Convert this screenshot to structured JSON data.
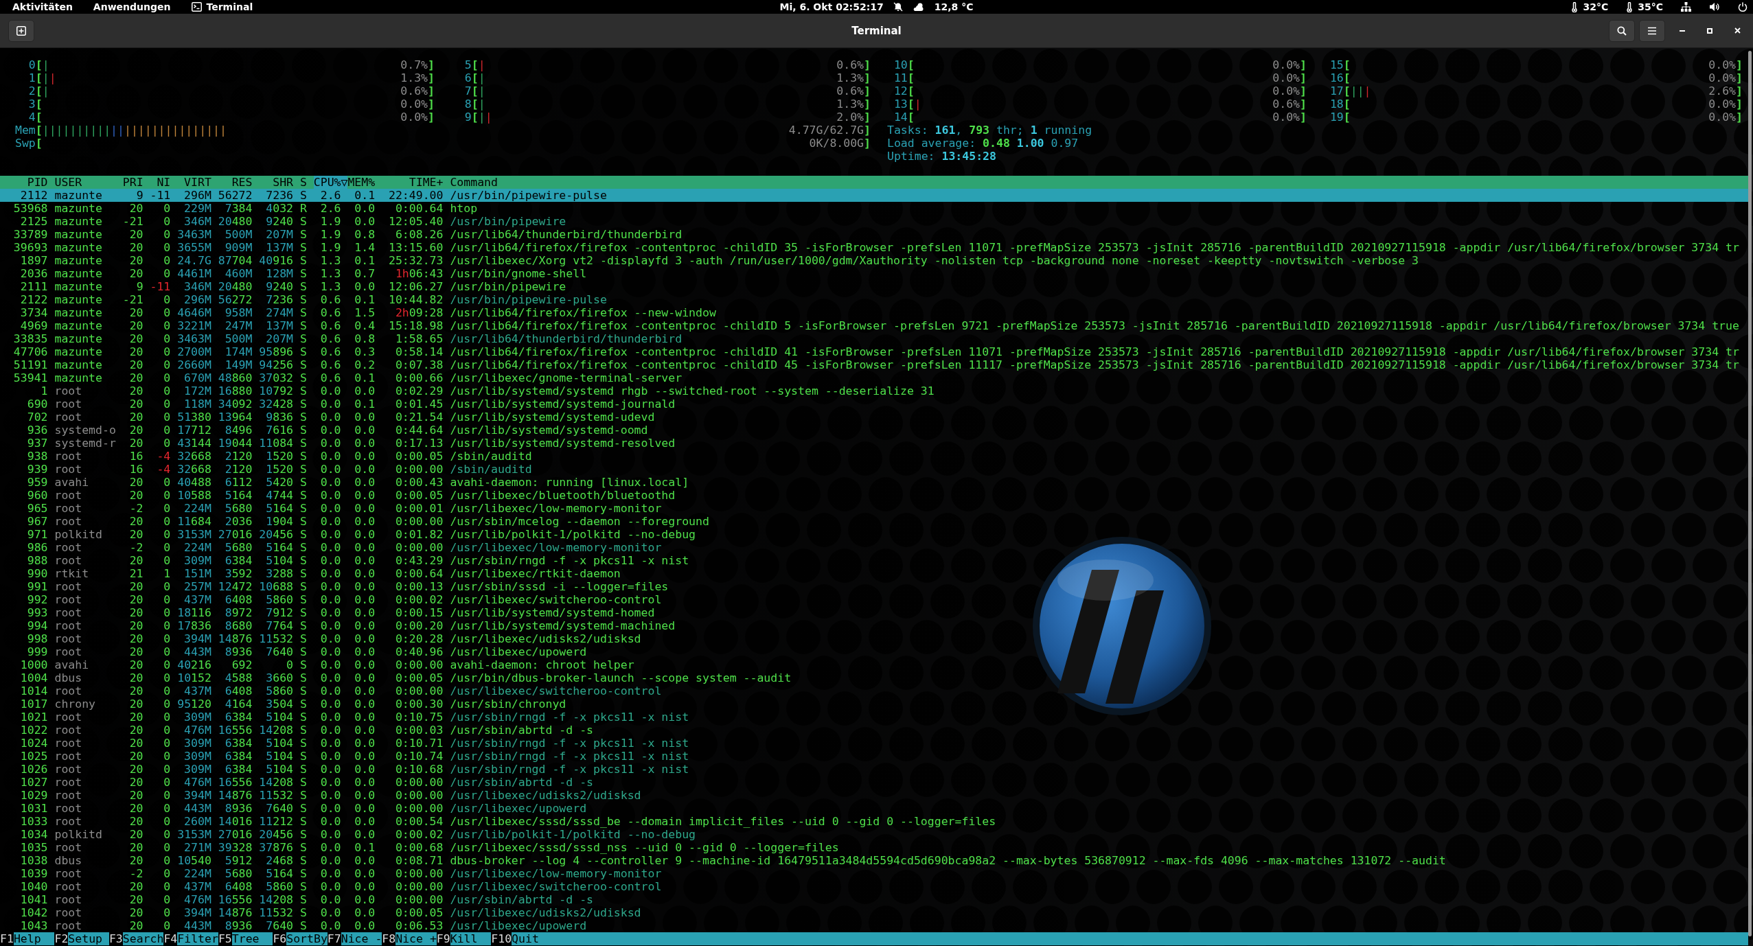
{
  "top_bar": {
    "activities": "Aktivitäten",
    "applications": "Anwendungen",
    "app": "Terminal",
    "clock": "Mi, 6. Okt 02:52:17",
    "weather": "12,8 °C",
    "temperatures": [
      "32°C",
      "35°C"
    ]
  },
  "window": {
    "title": "Terminal"
  },
  "cpus": [
    {
      "label": "0",
      "open": "[",
      "segments": [
        {
          "kind": "user",
          "text": "|"
        }
      ],
      "reading": "0.7%",
      "close": "]"
    },
    {
      "label": "1",
      "open": "[",
      "segments": [
        {
          "kind": "user",
          "text": "|"
        },
        {
          "kind": "kernel",
          "text": "|"
        }
      ],
      "reading": "1.3%",
      "close": "]"
    },
    {
      "label": "2",
      "open": "[",
      "segments": [
        {
          "kind": "user",
          "text": "|"
        }
      ],
      "reading": "0.6%",
      "close": "]"
    },
    {
      "label": "3",
      "open": "[",
      "reading": "0.0%",
      "close": "]"
    },
    {
      "label": "4",
      "open": "[",
      "reading": "0.0%",
      "close": "]"
    },
    {
      "label": "5",
      "open": "[",
      "segments": [
        {
          "kind": "kernel",
          "text": "|"
        }
      ],
      "reading": "0.6%",
      "close": "]"
    },
    {
      "label": "6",
      "open": "[",
      "segments": [
        {
          "kind": "user",
          "text": "|"
        }
      ],
      "reading": "1.3%",
      "close": "]"
    },
    {
      "label": "7",
      "open": "[",
      "segments": [
        {
          "kind": "user",
          "text": "|"
        }
      ],
      "reading": "0.6%",
      "close": "]"
    },
    {
      "label": "8",
      "open": "[",
      "segments": [
        {
          "kind": "user",
          "text": "|"
        }
      ],
      "reading": "1.3%",
      "close": "]"
    },
    {
      "label": "9",
      "open": "[",
      "segments": [
        {
          "kind": "user",
          "text": "|"
        },
        {
          "kind": "kernel",
          "text": "|"
        }
      ],
      "reading": "2.0%",
      "close": "]"
    },
    {
      "label": "10",
      "open": "[",
      "reading": "0.0%",
      "close": "]"
    },
    {
      "label": "11",
      "open": "[",
      "reading": "0.0%",
      "close": "]"
    },
    {
      "label": "12",
      "open": "[",
      "reading": "0.0%",
      "close": "]"
    },
    {
      "label": "13",
      "open": "[",
      "segments": [
        {
          "kind": "kernel",
          "text": "|"
        }
      ],
      "reading": "0.6%",
      "close": "]"
    },
    {
      "label": "14",
      "open": "[",
      "reading": "0.0%",
      "close": "]"
    },
    {
      "label": "15",
      "open": "[",
      "reading": "0.0%",
      "close": "]"
    },
    {
      "label": "16",
      "open": "[",
      "reading": "0.0%",
      "close": "]"
    },
    {
      "label": "17",
      "open": "[",
      "segments": [
        {
          "kind": "user",
          "text": "||"
        },
        {
          "kind": "kernel",
          "text": "|"
        }
      ],
      "reading": "2.6%",
      "close": "]"
    },
    {
      "label": "18",
      "open": "[",
      "reading": "0.0%",
      "close": "]"
    },
    {
      "label": "19",
      "open": "[",
      "reading": "0.0%",
      "close": "]"
    }
  ],
  "memory": {
    "label": "Mem",
    "open": "[",
    "segments": [
      {
        "kind": "user",
        "text": "||||||||||"
      },
      {
        "kind": "buffers",
        "text": "||"
      },
      {
        "kind": "cache",
        "text": "|||||||||||||||"
      }
    ],
    "reading": "4.77G/62.7G",
    "close": "]"
  },
  "swap": {
    "label": "Swp",
    "open": "[",
    "reading": "0K/8.00G",
    "close": "]"
  },
  "tasks": "Tasks: **161**, **793** thr; **1** running",
  "load_average": "Load average: **0.48** **1.00** 0.97",
  "uptime": "Uptime: **13:45:28**",
  "columns": [
    {
      "label": "PID",
      "sorted": false
    },
    {
      "label": "USER",
      "sorted": false
    },
    {
      "label": "PRI",
      "sorted": false
    },
    {
      "label": "NI",
      "sorted": false
    },
    {
      "label": "VIRT",
      "sorted": false
    },
    {
      "label": "RES",
      "sorted": false
    },
    {
      "label": "SHR",
      "sorted": false
    },
    {
      "label": "S",
      "sorted": false
    },
    {
      "label": "CPU%▽",
      "sorted": true
    },
    {
      "label": "MEM%",
      "sorted": false
    },
    {
      "label": "TIME+",
      "sorted": false
    },
    {
      "label": "Command",
      "sorted": false
    }
  ],
  "processes": [
    {
      "pid": "2112",
      "user": "mazunte",
      "pri": "9",
      "ni": "-11",
      "virt": "296M",
      "res": "56272",
      "shr": "7236",
      "state": "S",
      "cpu": "2.6",
      "mem": "0.1",
      "time": "22:49.00",
      "command": "/usr/bin/pipewire-pulse",
      "own": true,
      "thread": false,
      "selected": true
    },
    {
      "pid": "53968",
      "user": "mazunte",
      "pri": "20",
      "ni": "0",
      "virt": "229M",
      "res": "7384",
      "shr": "4032",
      "state": "R",
      "cpu": "2.6",
      "mem": "0.0",
      "time": "0:00.64",
      "command": "htop",
      "own": true,
      "thread": false,
      "selected": false
    },
    {
      "pid": "2125",
      "user": "mazunte",
      "pri": "-21",
      "ni": "0",
      "virt": "346M",
      "res": "20480",
      "shr": "9240",
      "state": "S",
      "cpu": "1.9",
      "mem": "0.0",
      "time": "12:05.40",
      "command": "/usr/bin/pipewire",
      "own": true,
      "thread": true,
      "selected": false
    },
    {
      "pid": "33789",
      "user": "mazunte",
      "pri": "20",
      "ni": "0",
      "virt": "3463M",
      "res": "500M",
      "shr": "207M",
      "state": "S",
      "cpu": "1.9",
      "mem": "0.8",
      "time": "6:08.26",
      "command": "/usr/lib64/thunderbird/thunderbird",
      "own": true,
      "thread": false,
      "selected": false
    },
    {
      "pid": "39693",
      "user": "mazunte",
      "pri": "20",
      "ni": "0",
      "virt": "3655M",
      "res": "909M",
      "shr": "137M",
      "state": "S",
      "cpu": "1.9",
      "mem": "1.4",
      "time": "13:15.60",
      "command": "/usr/lib64/firefox/firefox -contentproc -childID 35 -isForBrowser -prefsLen 11071 -prefMapSize 253573 -jsInit 285716 -parentBuildID 20210927115918 -appdir /usr/lib64/firefox/browser 3734 tr",
      "own": true,
      "thread": false,
      "selected": false
    },
    {
      "pid": "1897",
      "user": "mazunte",
      "pri": "20",
      "ni": "0",
      "virt": "24.7G",
      "res": "87704",
      "shr": "40916",
      "state": "S",
      "cpu": "1.3",
      "mem": "0.1",
      "time": "25:32.73",
      "command": "/usr/libexec/Xorg vt2 -displayfd 3 -auth /run/user/1000/gdm/Xauthority -nolisten tcp -background none -noreset -keeptty -novtswitch -verbose 3",
      "own": true,
      "thread": false,
      "selected": false
    },
    {
      "pid": "2036",
      "user": "mazunte",
      "pri": "20",
      "ni": "0",
      "virt": "4461M",
      "res": "460M",
      "shr": "128M",
      "state": "S",
      "cpu": "1.3",
      "mem": "0.7",
      "time": "1h06:43",
      "command": "/usr/bin/gnome-shell",
      "own": true,
      "thread": false,
      "selected": false
    },
    {
      "pid": "2111",
      "user": "mazunte",
      "pri": "9",
      "ni": "-11",
      "virt": "346M",
      "res": "20480",
      "shr": "9240",
      "state": "S",
      "cpu": "1.3",
      "mem": "0.0",
      "time": "12:06.27",
      "command": "/usr/bin/pipewire",
      "own": true,
      "thread": false,
      "selected": false
    },
    {
      "pid": "2122",
      "user": "mazunte",
      "pri": "-21",
      "ni": "0",
      "virt": "296M",
      "res": "56272",
      "shr": "7236",
      "state": "S",
      "cpu": "0.6",
      "mem": "0.1",
      "time": "10:44.82",
      "command": "/usr/bin/pipewire-pulse",
      "own": true,
      "thread": true,
      "selected": false
    },
    {
      "pid": "3734",
      "user": "mazunte",
      "pri": "20",
      "ni": "0",
      "virt": "4646M",
      "res": "958M",
      "shr": "274M",
      "state": "S",
      "cpu": "0.6",
      "mem": "1.5",
      "time": "2h09:28",
      "command": "/usr/lib64/firefox/firefox --new-window",
      "own": true,
      "thread": false,
      "selected": false
    },
    {
      "pid": "4969",
      "user": "mazunte",
      "pri": "20",
      "ni": "0",
      "virt": "3221M",
      "res": "247M",
      "shr": "137M",
      "state": "S",
      "cpu": "0.6",
      "mem": "0.4",
      "time": "15:18.98",
      "command": "/usr/lib64/firefox/firefox -contentproc -childID 5 -isForBrowser -prefsLen 9721 -prefMapSize 253573 -jsInit 285716 -parentBuildID 20210927115918 -appdir /usr/lib64/firefox/browser 3734 true",
      "own": true,
      "thread": false,
      "selected": false
    },
    {
      "pid": "33835",
      "user": "mazunte",
      "pri": "20",
      "ni": "0",
      "virt": "3463M",
      "res": "500M",
      "shr": "207M",
      "state": "S",
      "cpu": "0.6",
      "mem": "0.8",
      "time": "1:58.65",
      "command": "/usr/lib64/thunderbird/thunderbird",
      "own": true,
      "thread": true,
      "selected": false
    },
    {
      "pid": "47706",
      "user": "mazunte",
      "pri": "20",
      "ni": "0",
      "virt": "2700M",
      "res": "174M",
      "shr": "95896",
      "state": "S",
      "cpu": "0.6",
      "mem": "0.3",
      "time": "0:58.14",
      "command": "/usr/lib64/firefox/firefox -contentproc -childID 41 -isForBrowser -prefsLen 11071 -prefMapSize 253573 -jsInit 285716 -parentBuildID 20210927115918 -appdir /usr/lib64/firefox/browser 3734 tr",
      "own": true,
      "thread": false,
      "selected": false
    },
    {
      "pid": "51191",
      "user": "mazunte",
      "pri": "20",
      "ni": "0",
      "virt": "2660M",
      "res": "149M",
      "shr": "94256",
      "state": "S",
      "cpu": "0.6",
      "mem": "0.2",
      "time": "0:07.38",
      "command": "/usr/lib64/firefox/firefox -contentproc -childID 45 -isForBrowser -prefsLen 11117 -prefMapSize 253573 -jsInit 285716 -parentBuildID 20210927115918 -appdir /usr/lib64/firefox/browser 3734 tr",
      "own": true,
      "thread": false,
      "selected": false
    },
    {
      "pid": "53941",
      "user": "mazunte",
      "pri": "20",
      "ni": "0",
      "virt": "670M",
      "res": "48860",
      "shr": "37032",
      "state": "S",
      "cpu": "0.6",
      "mem": "0.1",
      "time": "0:00.66",
      "command": "/usr/libexec/gnome-terminal-server",
      "own": true,
      "thread": false,
      "selected": false
    },
    {
      "pid": "1",
      "user": "root",
      "pri": "20",
      "ni": "0",
      "virt": "172M",
      "res": "16880",
      "shr": "10792",
      "state": "S",
      "cpu": "0.0",
      "mem": "0.0",
      "time": "0:02.29",
      "command": "/usr/lib/systemd/systemd rhgb --switched-root --system --deserialize 31",
      "own": false,
      "thread": false,
      "selected": false
    },
    {
      "pid": "690",
      "user": "root",
      "pri": "20",
      "ni": "0",
      "virt": "118M",
      "res": "34092",
      "shr": "32428",
      "state": "S",
      "cpu": "0.0",
      "mem": "0.1",
      "time": "0:01.45",
      "command": "/usr/lib/systemd/systemd-journald",
      "own": false,
      "thread": false,
      "selected": false
    },
    {
      "pid": "702",
      "user": "root",
      "pri": "20",
      "ni": "0",
      "virt": "51380",
      "res": "13964",
      "shr": "9836",
      "state": "S",
      "cpu": "0.0",
      "mem": "0.0",
      "time": "0:21.54",
      "command": "/usr/lib/systemd/systemd-udevd",
      "own": false,
      "thread": false,
      "selected": false
    },
    {
      "pid": "936",
      "user": "systemd-o",
      "pri": "20",
      "ni": "0",
      "virt": "17712",
      "res": "8496",
      "shr": "7616",
      "state": "S",
      "cpu": "0.0",
      "mem": "0.0",
      "time": "0:44.64",
      "command": "/usr/lib/systemd/systemd-oomd",
      "own": false,
      "thread": false,
      "selected": false
    },
    {
      "pid": "937",
      "user": "systemd-r",
      "pri": "20",
      "ni": "0",
      "virt": "43144",
      "res": "19044",
      "shr": "11084",
      "state": "S",
      "cpu": "0.0",
      "mem": "0.0",
      "time": "0:17.13",
      "command": "/usr/lib/systemd/systemd-resolved",
      "own": false,
      "thread": false,
      "selected": false
    },
    {
      "pid": "938",
      "user": "root",
      "pri": "16",
      "ni": "-4",
      "virt": "32668",
      "res": "2120",
      "shr": "1520",
      "state": "S",
      "cpu": "0.0",
      "mem": "0.0",
      "time": "0:00.05",
      "command": "/sbin/auditd",
      "own": false,
      "thread": false,
      "selected": false
    },
    {
      "pid": "939",
      "user": "root",
      "pri": "16",
      "ni": "-4",
      "virt": "32668",
      "res": "2120",
      "shr": "1520",
      "state": "S",
      "cpu": "0.0",
      "mem": "0.0",
      "time": "0:00.00",
      "command": "/sbin/auditd",
      "own": false,
      "thread": true,
      "selected": false
    },
    {
      "pid": "959",
      "user": "avahi",
      "pri": "20",
      "ni": "0",
      "virt": "40488",
      "res": "6112",
      "shr": "5420",
      "state": "S",
      "cpu": "0.0",
      "mem": "0.0",
      "time": "0:00.43",
      "command": "avahi-daemon: running [linux.local]",
      "own": false,
      "thread": false,
      "selected": false
    },
    {
      "pid": "960",
      "user": "root",
      "pri": "20",
      "ni": "0",
      "virt": "10588",
      "res": "5164",
      "shr": "4744",
      "state": "S",
      "cpu": "0.0",
      "mem": "0.0",
      "time": "0:00.05",
      "command": "/usr/libexec/bluetooth/bluetoothd",
      "own": false,
      "thread": false,
      "selected": false
    },
    {
      "pid": "965",
      "user": "root",
      "pri": "-2",
      "ni": "0",
      "virt": "224M",
      "res": "5680",
      "shr": "5164",
      "state": "S",
      "cpu": "0.0",
      "mem": "0.0",
      "time": "0:00.01",
      "command": "/usr/libexec/low-memory-monitor",
      "own": false,
      "thread": false,
      "selected": false
    },
    {
      "pid": "967",
      "user": "root",
      "pri": "20",
      "ni": "0",
      "virt": "11684",
      "res": "2036",
      "shr": "1904",
      "state": "S",
      "cpu": "0.0",
      "mem": "0.0",
      "time": "0:00.00",
      "command": "/usr/sbin/mcelog --daemon --foreground",
      "own": false,
      "thread": false,
      "selected": false
    },
    {
      "pid": "971",
      "user": "polkitd",
      "pri": "20",
      "ni": "0",
      "virt": "3153M",
      "res": "27016",
      "shr": "20456",
      "state": "S",
      "cpu": "0.0",
      "mem": "0.0",
      "time": "0:01.82",
      "command": "/usr/lib/polkit-1/polkitd --no-debug",
      "own": false,
      "thread": false,
      "selected": false
    },
    {
      "pid": "986",
      "user": "root",
      "pri": "-2",
      "ni": "0",
      "virt": "224M",
      "res": "5680",
      "shr": "5164",
      "state": "S",
      "cpu": "0.0",
      "mem": "0.0",
      "time": "0:00.00",
      "command": "/usr/libexec/low-memory-monitor",
      "own": false,
      "thread": true,
      "selected": false
    },
    {
      "pid": "988",
      "user": "root",
      "pri": "20",
      "ni": "0",
      "virt": "309M",
      "res": "6384",
      "shr": "5104",
      "state": "S",
      "cpu": "0.0",
      "mem": "0.0",
      "time": "0:43.29",
      "command": "/usr/sbin/rngd -f -x pkcs11 -x nist",
      "own": false,
      "thread": false,
      "selected": false
    },
    {
      "pid": "990",
      "user": "rtkit",
      "pri": "21",
      "ni": "1",
      "virt": "151M",
      "res": "3592",
      "shr": "3288",
      "state": "S",
      "cpu": "0.0",
      "mem": "0.0",
      "time": "0:00.64",
      "command": "/usr/libexec/rtkit-daemon",
      "own": false,
      "thread": false,
      "selected": false
    },
    {
      "pid": "991",
      "user": "root",
      "pri": "20",
      "ni": "0",
      "virt": "257M",
      "res": "12472",
      "shr": "10688",
      "state": "S",
      "cpu": "0.0",
      "mem": "0.0",
      "time": "0:00.13",
      "command": "/usr/sbin/sssd -i --logger=files",
      "own": false,
      "thread": false,
      "selected": false
    },
    {
      "pid": "992",
      "user": "root",
      "pri": "20",
      "ni": "0",
      "virt": "437M",
      "res": "6408",
      "shr": "5860",
      "state": "S",
      "cpu": "0.0",
      "mem": "0.0",
      "time": "0:00.02",
      "command": "/usr/libexec/switcheroo-control",
      "own": false,
      "thread": false,
      "selected": false
    },
    {
      "pid": "993",
      "user": "root",
      "pri": "20",
      "ni": "0",
      "virt": "18116",
      "res": "8972",
      "shr": "7912",
      "state": "S",
      "cpu": "0.0",
      "mem": "0.0",
      "time": "0:00.15",
      "command": "/usr/lib/systemd/systemd-homed",
      "own": false,
      "thread": false,
      "selected": false
    },
    {
      "pid": "994",
      "user": "root",
      "pri": "20",
      "ni": "0",
      "virt": "17836",
      "res": "8680",
      "shr": "7764",
      "state": "S",
      "cpu": "0.0",
      "mem": "0.0",
      "time": "0:00.20",
      "command": "/usr/lib/systemd/systemd-machined",
      "own": false,
      "thread": false,
      "selected": false
    },
    {
      "pid": "998",
      "user": "root",
      "pri": "20",
      "ni": "0",
      "virt": "394M",
      "res": "14876",
      "shr": "11532",
      "state": "S",
      "cpu": "0.0",
      "mem": "0.0",
      "time": "0:20.28",
      "command": "/usr/libexec/udisks2/udisksd",
      "own": false,
      "thread": false,
      "selected": false
    },
    {
      "pid": "999",
      "user": "root",
      "pri": "20",
      "ni": "0",
      "virt": "443M",
      "res": "8936",
      "shr": "7640",
      "state": "S",
      "cpu": "0.0",
      "mem": "0.0",
      "time": "0:40.96",
      "command": "/usr/libexec/upowerd",
      "own": false,
      "thread": false,
      "selected": false
    },
    {
      "pid": "1000",
      "user": "avahi",
      "pri": "20",
      "ni": "0",
      "virt": "40216",
      "res": "692",
      "shr": "0",
      "state": "S",
      "cpu": "0.0",
      "mem": "0.0",
      "time": "0:00.00",
      "command": "avahi-daemon: chroot helper",
      "own": false,
      "thread": false,
      "selected": false
    },
    {
      "pid": "1004",
      "user": "dbus",
      "pri": "20",
      "ni": "0",
      "virt": "10152",
      "res": "4588",
      "shr": "3660",
      "state": "S",
      "cpu": "0.0",
      "mem": "0.0",
      "time": "0:00.05",
      "command": "/usr/bin/dbus-broker-launch --scope system --audit",
      "own": false,
      "thread": false,
      "selected": false
    },
    {
      "pid": "1014",
      "user": "root",
      "pri": "20",
      "ni": "0",
      "virt": "437M",
      "res": "6408",
      "shr": "5860",
      "state": "S",
      "cpu": "0.0",
      "mem": "0.0",
      "time": "0:00.00",
      "command": "/usr/libexec/switcheroo-control",
      "own": false,
      "thread": true,
      "selected": false
    },
    {
      "pid": "1017",
      "user": "chrony",
      "pri": "20",
      "ni": "0",
      "virt": "95120",
      "res": "4164",
      "shr": "3504",
      "state": "S",
      "cpu": "0.0",
      "mem": "0.0",
      "time": "0:00.30",
      "command": "/usr/sbin/chronyd",
      "own": false,
      "thread": false,
      "selected": false
    },
    {
      "pid": "1021",
      "user": "root",
      "pri": "20",
      "ni": "0",
      "virt": "309M",
      "res": "6384",
      "shr": "5104",
      "state": "S",
      "cpu": "0.0",
      "mem": "0.0",
      "time": "0:10.75",
      "command": "/usr/sbin/rngd -f -x pkcs11 -x nist",
      "own": false,
      "thread": true,
      "selected": false
    },
    {
      "pid": "1022",
      "user": "root",
      "pri": "20",
      "ni": "0",
      "virt": "476M",
      "res": "16556",
      "shr": "14208",
      "state": "S",
      "cpu": "0.0",
      "mem": "0.0",
      "time": "0:00.03",
      "command": "/usr/sbin/abrtd -d -s",
      "own": false,
      "thread": false,
      "selected": false
    },
    {
      "pid": "1024",
      "user": "root",
      "pri": "20",
      "ni": "0",
      "virt": "309M",
      "res": "6384",
      "shr": "5104",
      "state": "S",
      "cpu": "0.0",
      "mem": "0.0",
      "time": "0:10.71",
      "command": "/usr/sbin/rngd -f -x pkcs11 -x nist",
      "own": false,
      "thread": true,
      "selected": false
    },
    {
      "pid": "1025",
      "user": "root",
      "pri": "20",
      "ni": "0",
      "virt": "309M",
      "res": "6384",
      "shr": "5104",
      "state": "S",
      "cpu": "0.0",
      "mem": "0.0",
      "time": "0:10.74",
      "command": "/usr/sbin/rngd -f -x pkcs11 -x nist",
      "own": false,
      "thread": true,
      "selected": false
    },
    {
      "pid": "1026",
      "user": "root",
      "pri": "20",
      "ni": "0",
      "virt": "309M",
      "res": "6384",
      "shr": "5104",
      "state": "S",
      "cpu": "0.0",
      "mem": "0.0",
      "time": "0:10.68",
      "command": "/usr/sbin/rngd -f -x pkcs11 -x nist",
      "own": false,
      "thread": true,
      "selected": false
    },
    {
      "pid": "1027",
      "user": "root",
      "pri": "20",
      "ni": "0",
      "virt": "476M",
      "res": "16556",
      "shr": "14208",
      "state": "S",
      "cpu": "0.0",
      "mem": "0.0",
      "time": "0:00.00",
      "command": "/usr/sbin/abrtd -d -s",
      "own": false,
      "thread": true,
      "selected": false
    },
    {
      "pid": "1029",
      "user": "root",
      "pri": "20",
      "ni": "0",
      "virt": "394M",
      "res": "14876",
      "shr": "11532",
      "state": "S",
      "cpu": "0.0",
      "mem": "0.0",
      "time": "0:00.00",
      "command": "/usr/libexec/udisks2/udisksd",
      "own": false,
      "thread": true,
      "selected": false
    },
    {
      "pid": "1031",
      "user": "root",
      "pri": "20",
      "ni": "0",
      "virt": "443M",
      "res": "8936",
      "shr": "7640",
      "state": "S",
      "cpu": "0.0",
      "mem": "0.0",
      "time": "0:00.00",
      "command": "/usr/libexec/upowerd",
      "own": false,
      "thread": true,
      "selected": false
    },
    {
      "pid": "1033",
      "user": "root",
      "pri": "20",
      "ni": "0",
      "virt": "260M",
      "res": "14016",
      "shr": "11212",
      "state": "S",
      "cpu": "0.0",
      "mem": "0.0",
      "time": "0:00.54",
      "command": "/usr/libexec/sssd/sssd_be --domain implicit_files --uid 0 --gid 0 --logger=files",
      "own": false,
      "thread": false,
      "selected": false
    },
    {
      "pid": "1034",
      "user": "polkitd",
      "pri": "20",
      "ni": "0",
      "virt": "3153M",
      "res": "27016",
      "shr": "20456",
      "state": "S",
      "cpu": "0.0",
      "mem": "0.0",
      "time": "0:00.02",
      "command": "/usr/lib/polkit-1/polkitd --no-debug",
      "own": false,
      "thread": true,
      "selected": false
    },
    {
      "pid": "1035",
      "user": "root",
      "pri": "20",
      "ni": "0",
      "virt": "271M",
      "res": "39328",
      "shr": "37876",
      "state": "S",
      "cpu": "0.0",
      "mem": "0.1",
      "time": "0:00.68",
      "command": "/usr/libexec/sssd/sssd_nss --uid 0 --gid 0 --logger=files",
      "own": false,
      "thread": false,
      "selected": false
    },
    {
      "pid": "1038",
      "user": "dbus",
      "pri": "20",
      "ni": "0",
      "virt": "10540",
      "res": "5912",
      "shr": "2468",
      "state": "S",
      "cpu": "0.0",
      "mem": "0.0",
      "time": "0:08.71",
      "command": "dbus-broker --log 4 --controller 9 --machine-id 16479511a3484d5594cd5d690bca98a2 --max-bytes 536870912 --max-fds 4096 --max-matches 131072 --audit",
      "own": false,
      "thread": false,
      "selected": false
    },
    {
      "pid": "1039",
      "user": "root",
      "pri": "-2",
      "ni": "0",
      "virt": "224M",
      "res": "5680",
      "shr": "5164",
      "state": "S",
      "cpu": "0.0",
      "mem": "0.0",
      "time": "0:00.00",
      "command": "/usr/libexec/low-memory-monitor",
      "own": false,
      "thread": true,
      "selected": false
    },
    {
      "pid": "1040",
      "user": "root",
      "pri": "20",
      "ni": "0",
      "virt": "437M",
      "res": "6408",
      "shr": "5860",
      "state": "S",
      "cpu": "0.0",
      "mem": "0.0",
      "time": "0:00.00",
      "command": "/usr/libexec/switcheroo-control",
      "own": false,
      "thread": true,
      "selected": false
    },
    {
      "pid": "1041",
      "user": "root",
      "pri": "20",
      "ni": "0",
      "virt": "476M",
      "res": "16556",
      "shr": "14208",
      "state": "S",
      "cpu": "0.0",
      "mem": "0.0",
      "time": "0:00.00",
      "command": "/usr/sbin/abrtd -d -s",
      "own": false,
      "thread": true,
      "selected": false
    },
    {
      "pid": "1042",
      "user": "root",
      "pri": "20",
      "ni": "0",
      "virt": "394M",
      "res": "14876",
      "shr": "11532",
      "state": "S",
      "cpu": "0.0",
      "mem": "0.0",
      "time": "0:00.05",
      "command": "/usr/libexec/udisks2/udisksd",
      "own": false,
      "thread": true,
      "selected": false
    },
    {
      "pid": "1043",
      "user": "root",
      "pri": "20",
      "ni": "0",
      "virt": "443M",
      "res": "8936",
      "shr": "7640",
      "state": "S",
      "cpu": "0.0",
      "mem": "0.0",
      "time": "0:06.53",
      "command": "/usr/libexec/upowerd",
      "own": false,
      "thread": true,
      "selected": false
    }
  ],
  "function_keys": [
    {
      "key": "F1",
      "label": "Help"
    },
    {
      "key": "F2",
      "label": "Setup"
    },
    {
      "key": "F3",
      "label": "Search"
    },
    {
      "key": "F4",
      "label": "Filter"
    },
    {
      "key": "F5",
      "label": "Tree"
    },
    {
      "key": "F6",
      "label": "SortBy"
    },
    {
      "key": "F7",
      "label": "Nice -"
    },
    {
      "key": "F8",
      "label": "Nice +"
    },
    {
      "key": "F9",
      "label": "Kill"
    },
    {
      "key": "F10",
      "label": "Quit"
    }
  ]
}
